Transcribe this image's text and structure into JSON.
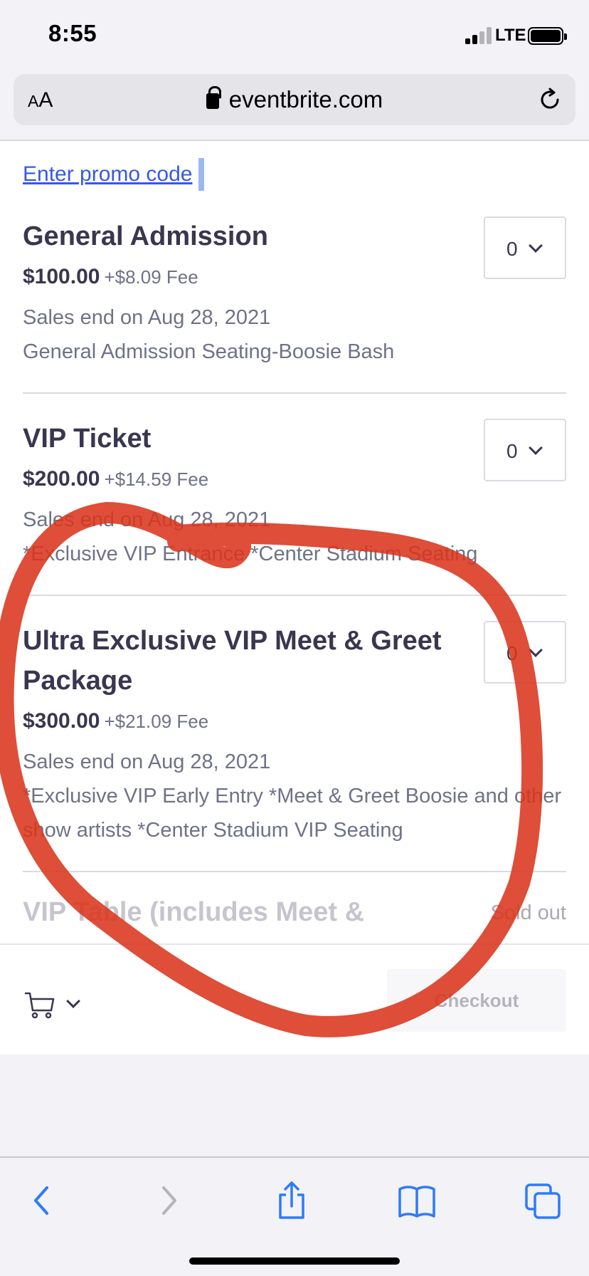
{
  "status_bar": {
    "time": "8:55",
    "network": "LTE"
  },
  "browser": {
    "text_size_label_small": "A",
    "text_size_label_large": "A",
    "url": "eventbrite.com"
  },
  "promo_link": "Enter promo code",
  "tickets": [
    {
      "name": "General Admission",
      "price": "$100.00",
      "fee": "+$8.09 Fee",
      "sales_end": "Sales end on Aug 28, 2021",
      "description": "General Admission Seating-Boosie Bash",
      "quantity": "0"
    },
    {
      "name": "VIP Ticket",
      "price": "$200.00",
      "fee": "+$14.59 Fee",
      "sales_end": "Sales end on Aug 28, 2021",
      "description": "*Exclusive VIP Entrance *Center Stadium Seating",
      "quantity": "0"
    },
    {
      "name": "Ultra Exclusive VIP Meet & Greet Package",
      "price": "$300.00",
      "fee": "+$21.09 Fee",
      "sales_end": "Sales end on Aug 28, 2021",
      "description": "*Exclusive VIP Early Entry  *Meet & Greet Boosie and other show artists *Center Stadium VIP Seating",
      "quantity": "0"
    },
    {
      "name": "VIP Table (includes Meet &",
      "status": "Sold out"
    }
  ],
  "footer": {
    "checkout_label": "Checkout"
  },
  "colors": {
    "link": "#3659e3",
    "annotation": "#d9361c",
    "text_primary": "#39364f",
    "text_secondary": "#6f7287"
  },
  "icons": [
    "lock-icon",
    "reload-icon",
    "cart-icon",
    "back-icon",
    "forward-icon",
    "share-icon",
    "bookmarks-icon",
    "tabs-icon"
  ]
}
